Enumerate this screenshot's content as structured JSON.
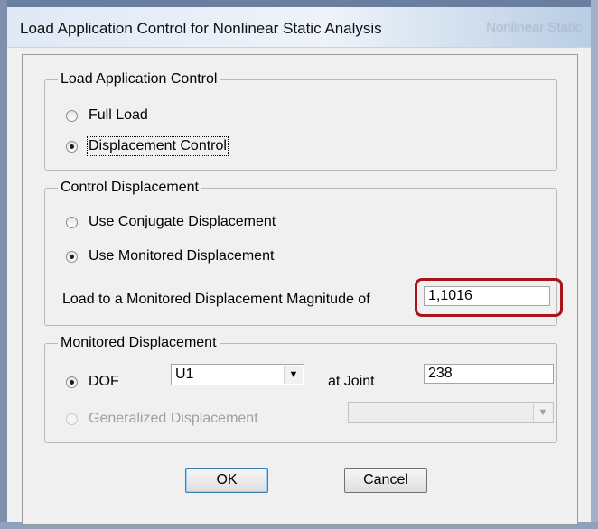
{
  "window": {
    "title": "Load Application Control for Nonlinear Static Analysis",
    "background_title": "Nonlinear Static"
  },
  "load_application_control": {
    "legend": "Load Application Control",
    "options": [
      {
        "label": "Full Load",
        "checked": false
      },
      {
        "label": "Displacement Control",
        "checked": true
      }
    ]
  },
  "control_displacement": {
    "legend": "Control Displacement",
    "options": [
      {
        "label": "Use Conjugate Displacement",
        "checked": false
      },
      {
        "label": "Use Monitored Displacement",
        "checked": true
      }
    ],
    "magnitude_label": "Load to a Monitored Displacement Magnitude of",
    "magnitude_value": "1,1016"
  },
  "monitored_displacement": {
    "legend": "Monitored Displacement",
    "dof_label": "DOF",
    "dof_value": "U1",
    "at_joint_label": "at Joint",
    "joint_value": "238",
    "generalized_label": "Generalized Displacement",
    "generalized_value": ""
  },
  "buttons": {
    "ok": "OK",
    "cancel": "Cancel"
  },
  "colors": {
    "highlight": "#a8131c"
  }
}
